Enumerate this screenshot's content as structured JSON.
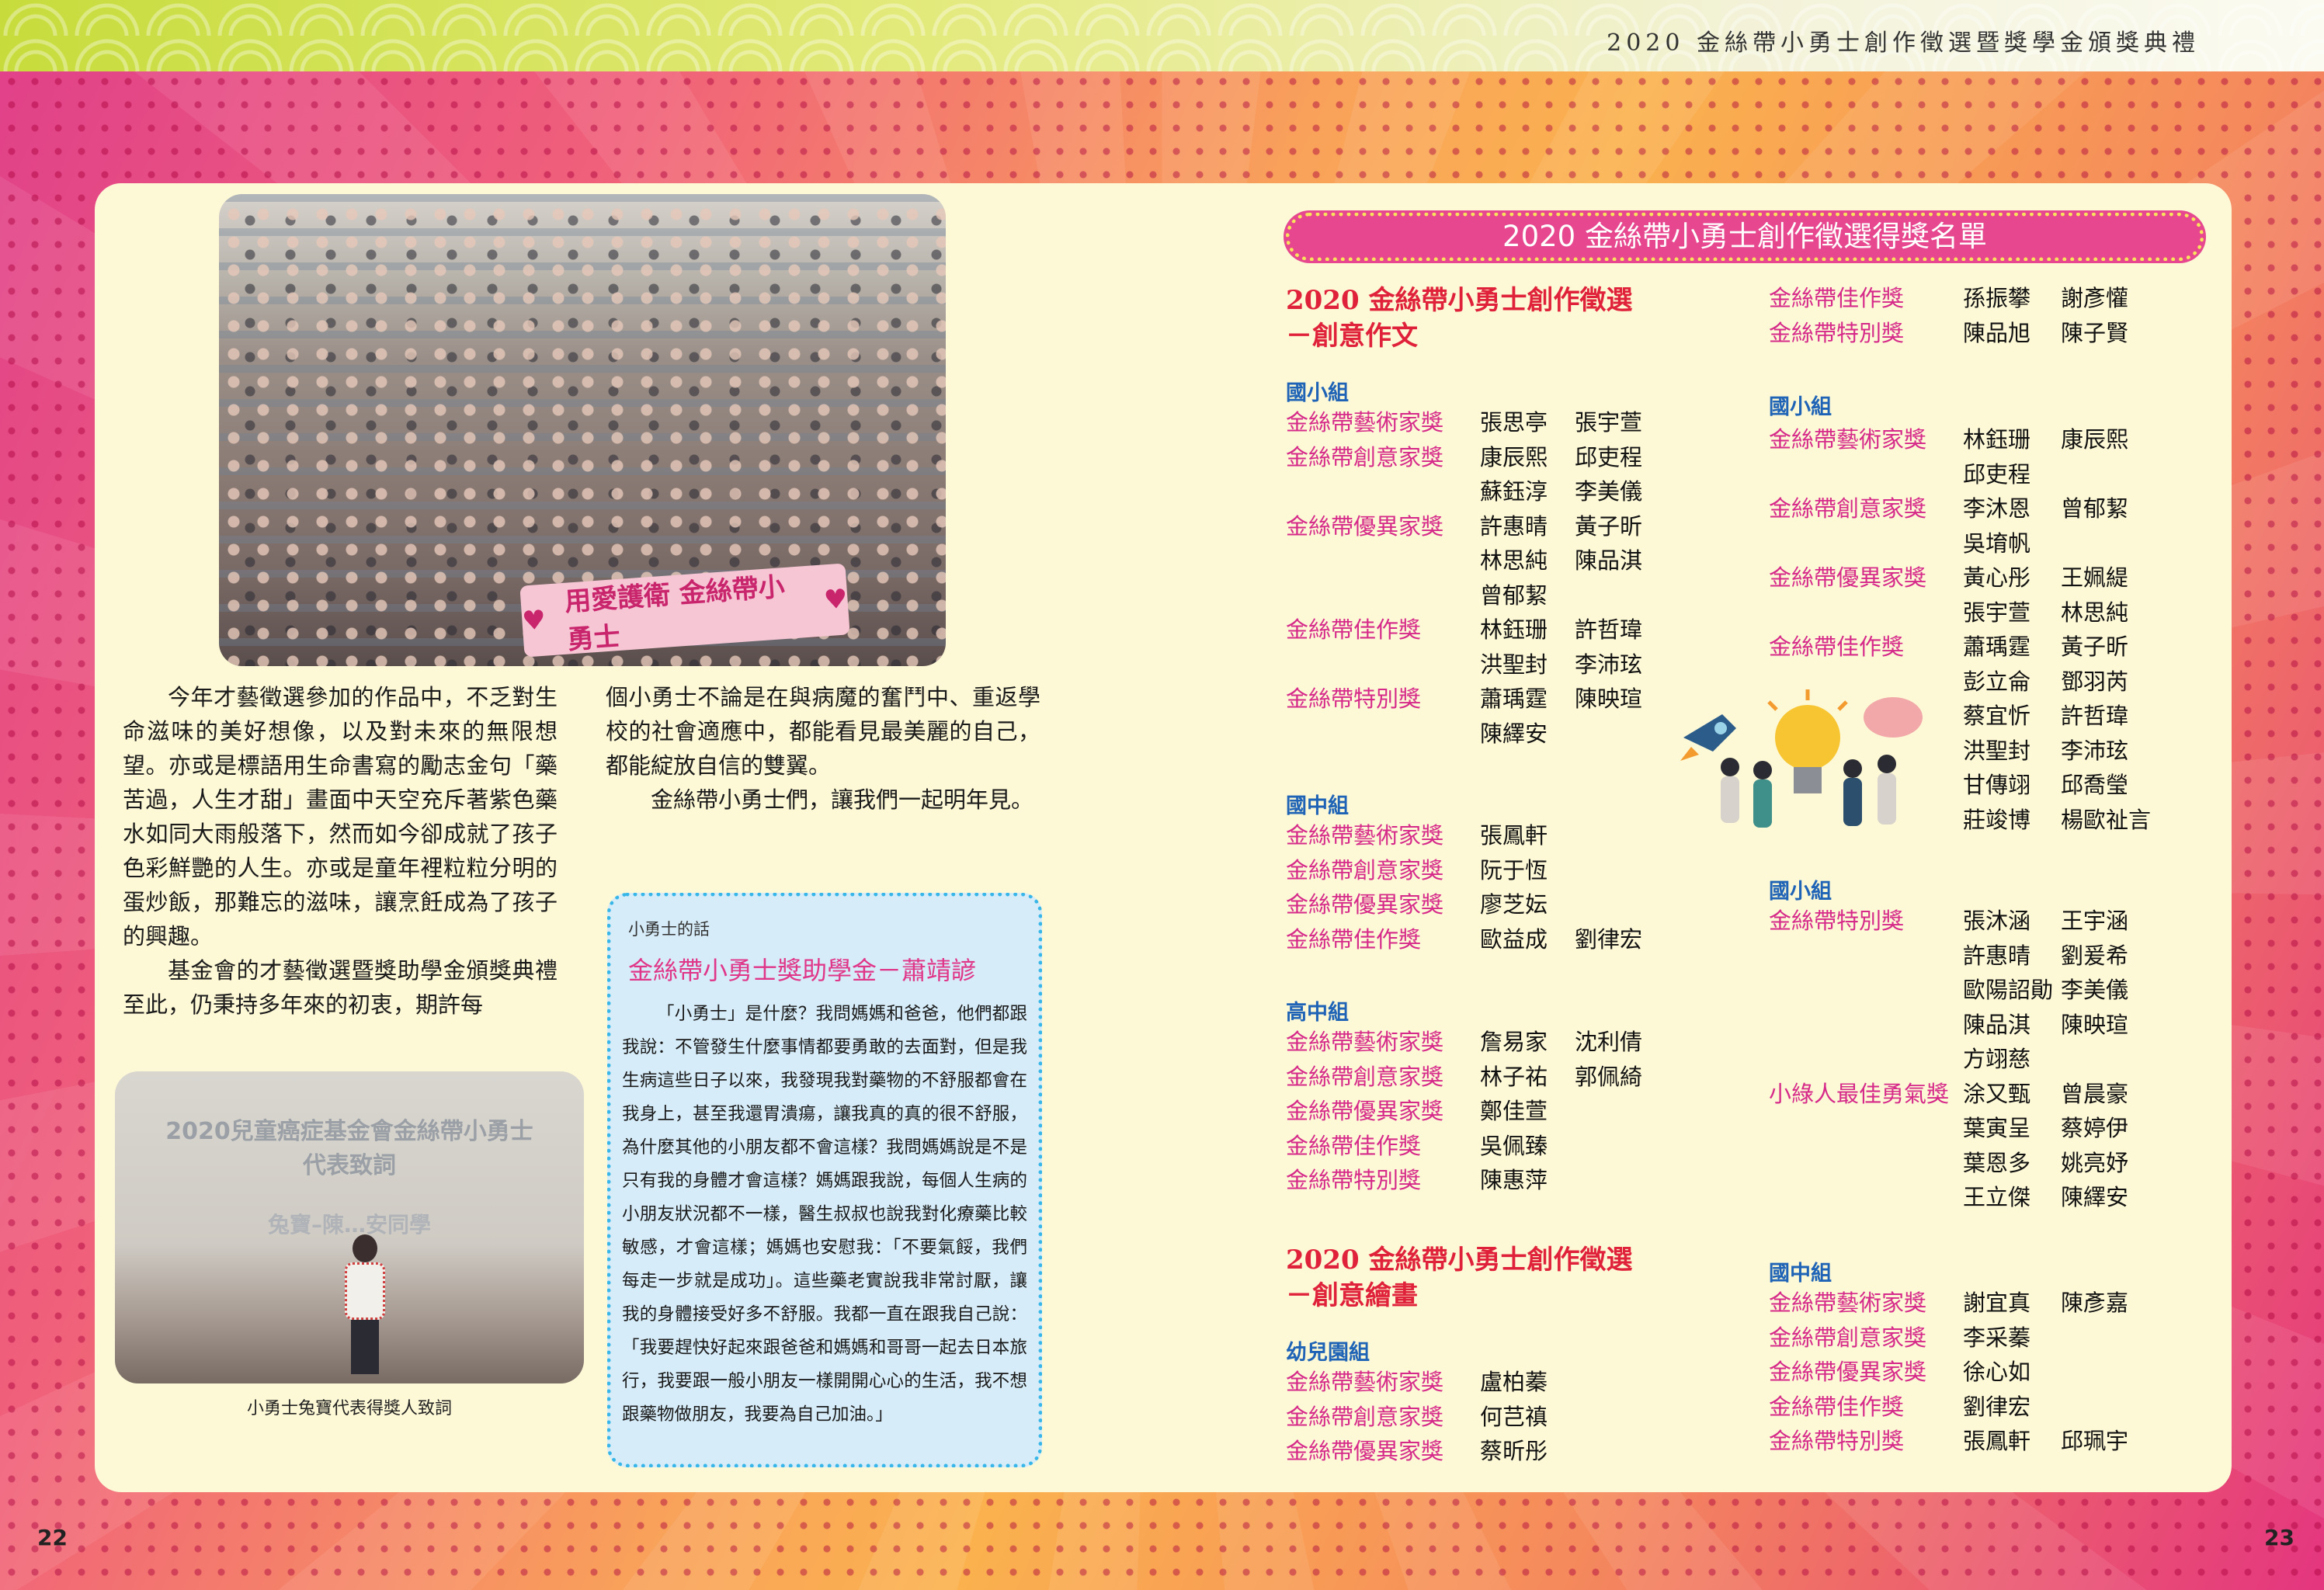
{
  "header": {
    "title": "2020 金絲帶小勇士創作徵選暨獎學金頒獎典禮"
  },
  "pages": {
    "left": "22",
    "right": "23"
  },
  "photo1": {
    "banner_text": "用愛護衛 金絲帶小勇士"
  },
  "photo2": {
    "stage_line1": "2020兒童癌症基金會金絲帶小勇士",
    "stage_line2": "代表致詞",
    "stage_line3": "兔寶–陳…安同學",
    "caption": "小勇士兔寶代表得獎人致詞"
  },
  "article": {
    "col1": [
      "今年才藝徵選參加的作品中，不乏對生命滋味的美好想像，以及對未來的無限想望。亦或是標語用生命書寫的勵志金句「藥苦過，人生才甜」畫面中天空充斥著紫色藥水如同大雨般落下，然而如今卻成就了孩子色彩鮮艷的人生。亦或是童年裡粒粒分明的蛋炒飯，那難忘的滋味，讓烹飪成為了孩子的興趣。",
      "基金會的才藝徵選暨獎助學金頒獎典禮至此，仍秉持多年來的初衷，期許每"
    ],
    "col2_cont": "個小勇士不論是在與病魔的奮鬥中、重返學校的社會適應中，都能看見最美麗的自己，都能綻放自信的雙翼。",
    "col2_p2": "金絲帶小勇士們，讓我們一起明年見。"
  },
  "quote": {
    "label": "小勇士的話",
    "title": "金絲帶小勇士獎助學金－蕭靖諺",
    "body": "「小勇士」是什麼？我問媽媽和爸爸，他們都跟我說：不管發生什麼事情都要勇敢的去面對，但是我生病這些日子以來，我發現我對藥物的不舒服都會在我身上，甚至我還胃潰瘍，讓我真的真的很不舒服，為什麼其他的小朋友都不會這樣？我問媽媽說是不是只有我的身體才會這樣？媽媽跟我說，每個人生病的小朋友狀況都不一樣，醫生叔叔也說我對化療藥比較敏感，才會這樣；媽媽也安慰我：「不要氣餒，我們每走一步就是成功」。這些藥老實說我非常討厭，讓我的身體接受好多不舒服。我都一直在跟我自己說：「我要趕快好起來跟爸爸和媽媽和哥哥一起去日本旅行，我要跟一般小朋友一樣開開心心的生活，我不想跟藥物做朋友，我要為自己加油。」"
  },
  "awards": {
    "title": "2020 金絲帶小勇士創作徵選得獎名單",
    "section1": {
      "line1": "2020 金絲帶小勇士創作徵選",
      "line2": "－創意作文"
    },
    "section2": {
      "line1": "2020 金絲帶小勇士創作徵選",
      "line2": "－創意繪畫"
    },
    "writing_elementary": {
      "group": "國小組",
      "rows": [
        [
          "金絲帶藝術家獎",
          "張思亭",
          "張宇萱"
        ],
        [
          "金絲帶創意家獎",
          "康辰熙",
          "邱吏程"
        ],
        [
          "",
          "蘇鈺淳",
          "李美儀"
        ],
        [
          "金絲帶優異家獎",
          "許惠晴",
          "黃子昕"
        ],
        [
          "",
          "林思純",
          "陳品淇"
        ],
        [
          "",
          "曾郁絜",
          ""
        ],
        [
          "金絲帶佳作獎",
          "林鈺珊",
          "許哲瑋"
        ],
        [
          "",
          "洪聖封",
          "李沛玹"
        ],
        [
          "金絲帶特別獎",
          "蕭瑀霆",
          "陳映瑄"
        ],
        [
          "",
          "陳繹安",
          ""
        ]
      ]
    },
    "writing_junior": {
      "group": "國中組",
      "rows": [
        [
          "金絲帶藝術家獎",
          "張鳳軒",
          ""
        ],
        [
          "金絲帶創意家獎",
          "阮于恆",
          ""
        ],
        [
          "金絲帶優異家獎",
          "廖芝妘",
          ""
        ],
        [
          "金絲帶佳作獎",
          "歐益成",
          "劉律宏"
        ]
      ]
    },
    "writing_senior": {
      "group": "高中組",
      "rows": [
        [
          "金絲帶藝術家獎",
          "詹易家",
          "沈利倩"
        ],
        [
          "金絲帶創意家獎",
          "林子祐",
          "郭佩綺"
        ],
        [
          "金絲帶優異家獎",
          "鄭佳萱",
          ""
        ],
        [
          "金絲帶佳作獎",
          "吳佩臻",
          ""
        ],
        [
          "金絲帶特別獎",
          "陳惠萍",
          ""
        ]
      ]
    },
    "drawing_kinder": {
      "group": "幼兒園組",
      "rows": [
        [
          "金絲帶藝術家獎",
          "盧柏蓁",
          ""
        ],
        [
          "金絲帶創意家獎",
          "何芑禛",
          ""
        ],
        [
          "金絲帶優異家獎",
          "蔡昕彤",
          ""
        ]
      ]
    },
    "drawing_kinder_cont": {
      "rows": [
        [
          "金絲帶佳作獎",
          "孫振攀",
          "謝彥懽"
        ],
        [
          "金絲帶特別獎",
          "陳品旭",
          "陳子賢"
        ]
      ]
    },
    "drawing_elementary": {
      "group": "國小組",
      "rows": [
        [
          "金絲帶藝術家獎",
          "林鈺珊",
          "康辰熙"
        ],
        [
          "",
          "邱吏程",
          ""
        ],
        [
          "金絲帶創意家獎",
          "李沐恩",
          "曾郁絜"
        ],
        [
          "",
          "吳堉帆",
          ""
        ],
        [
          "金絲帶優異家獎",
          "黃心彤",
          "王姵緹"
        ],
        [
          "",
          "張宇萱",
          "林思純"
        ],
        [
          "金絲帶佳作獎",
          "蕭瑀霆",
          "黃子昕"
        ],
        [
          "",
          "彭立侖",
          "鄧羽芮"
        ],
        [
          "",
          "蔡宜忻",
          "許哲瑋"
        ],
        [
          "",
          "洪聖封",
          "李沛玹"
        ],
        [
          "",
          "甘傳翊",
          "邱喬瑩"
        ],
        [
          "",
          "莊竣博",
          "楊歐祉言"
        ]
      ]
    },
    "drawing_elementary2": {
      "group": "國小組",
      "rows": [
        [
          "金絲帶特別獎",
          "張沐涵",
          "王宇涵"
        ],
        [
          "",
          "許惠晴",
          "劉爰希"
        ],
        [
          "",
          "歐陽詔勛",
          "李美儀"
        ],
        [
          "",
          "陳品淇",
          "陳映瑄"
        ],
        [
          "",
          "方翊慈",
          ""
        ],
        [
          "小綠人最佳勇氣獎",
          "涂又甄",
          "曾晨豪"
        ],
        [
          "",
          "葉寅呈",
          "蔡婷伊"
        ],
        [
          "",
          "葉恩多",
          "姚亮妤"
        ],
        [
          "",
          "王立傑",
          "陳繹安"
        ]
      ]
    },
    "drawing_junior": {
      "group": "國中組",
      "rows": [
        [
          "金絲帶藝術家獎",
          "謝宜真",
          "陳彥嘉"
        ],
        [
          "金絲帶創意家獎",
          "李采蓁",
          ""
        ],
        [
          "金絲帶優異家獎",
          "徐心如",
          ""
        ],
        [
          "金絲帶佳作獎",
          "劉律宏",
          ""
        ],
        [
          "金絲帶特別獎",
          "張鳳軒",
          "邱珮宇"
        ]
      ]
    }
  },
  "colors": {
    "award_label": "#d62a8a",
    "group_label": "#1e63b6",
    "section_title": "#e0213a",
    "panel_bg": "#fdf8d6"
  }
}
